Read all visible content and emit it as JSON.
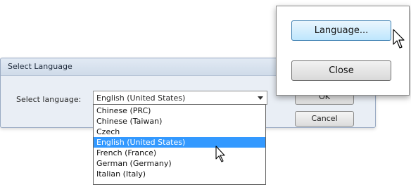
{
  "dialog": {
    "title": "Select Language",
    "select_label": "Select language:",
    "selected_value": "English (United States)",
    "ok_label": "OK",
    "cancel_label": "Cancel",
    "dropdown_options": [
      "Chinese (PRC)",
      "Chinese (Taiwan)",
      "Czech",
      "English (United States)",
      "French (France)",
      "German (Germany)",
      "Italian (Italy)"
    ],
    "highlighted_option": "English (United States)"
  },
  "panel": {
    "language_button_label": "Language...",
    "close_button_label": "Close"
  },
  "colors": {
    "selection": "#3399ff",
    "dialog_bg": "#e9eef5"
  },
  "icons": [
    "arrow-cursor-icon",
    "chevron-down-icon"
  ]
}
